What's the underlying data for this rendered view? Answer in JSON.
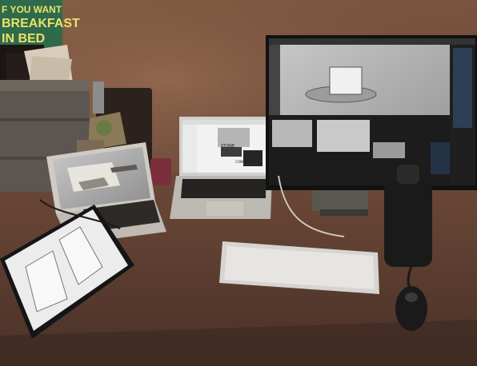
{
  "poster": {
    "line1": "F YOU WANT",
    "line2": "BREAKFAST",
    "line3": "IN BED"
  },
  "laptop_center_screen": {
    "label_top": "STONE",
    "label_bottom": "CONCRETE"
  },
  "scene_description_icons": [
    "desk",
    "monitor",
    "laptop",
    "tablet",
    "keyboard",
    "mouse",
    "water-bottle",
    "speaker"
  ]
}
